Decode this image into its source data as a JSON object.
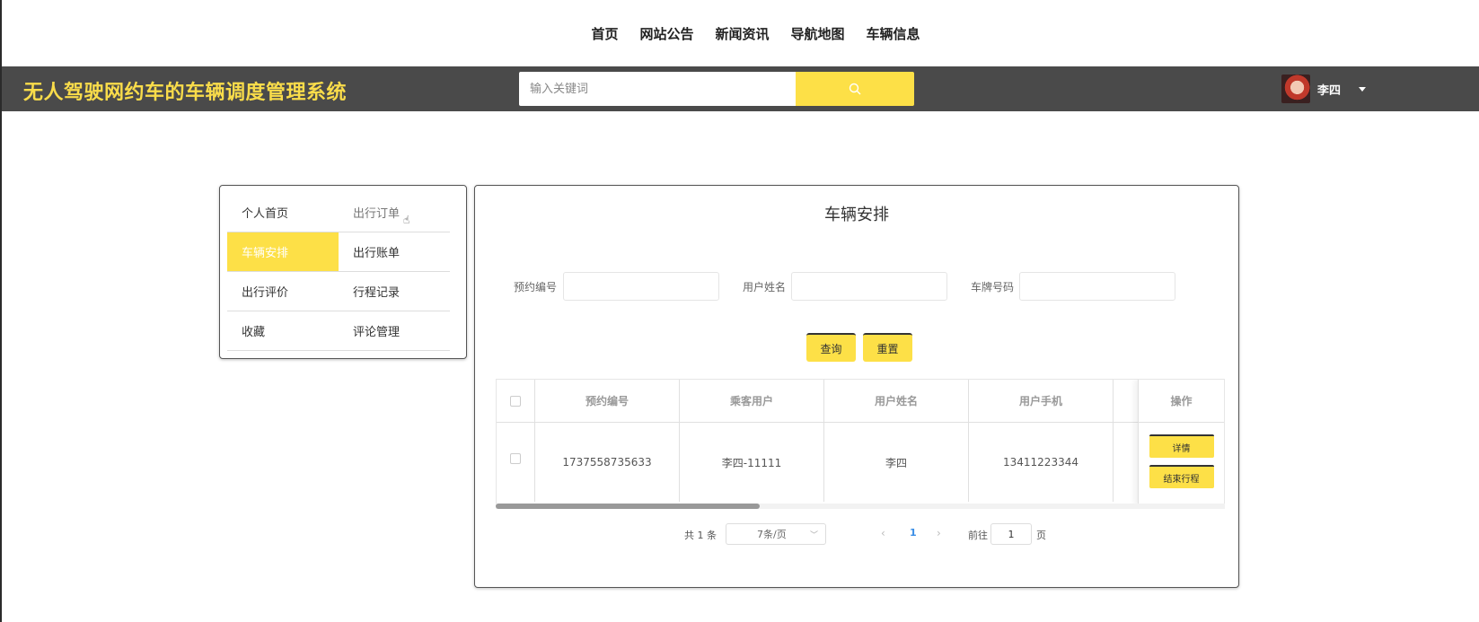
{
  "top_nav": [
    "首页",
    "网站公告",
    "新闻资讯",
    "导航地图",
    "车辆信息"
  ],
  "header": {
    "site_title": "无人驾驶网约车的车辆调度管理系统",
    "search_placeholder": "输入关键词",
    "search_icon": "search-icon",
    "user_name": "李四"
  },
  "side_menu": [
    {
      "label": "个人首页"
    },
    {
      "label": "出行订单"
    },
    {
      "label": "车辆安排",
      "active": true
    },
    {
      "label": "出行账单"
    },
    {
      "label": "出行评价"
    },
    {
      "label": "行程记录"
    },
    {
      "label": "收藏"
    },
    {
      "label": "评论管理"
    }
  ],
  "main": {
    "title": "车辆安排",
    "filters": [
      {
        "label": "预约编号",
        "value": ""
      },
      {
        "label": "用户姓名",
        "value": ""
      },
      {
        "label": "车牌号码",
        "value": ""
      }
    ],
    "query_button": "查询",
    "reset_button": "重置",
    "table": {
      "columns": [
        "预约编号",
        "乘客用户",
        "用户姓名",
        "用户手机",
        "操作"
      ],
      "rows": [
        {
          "cells": [
            "1737558735633",
            "李四-11111",
            "李四",
            "13411223344"
          ],
          "actions": [
            "详情",
            "结束行程"
          ]
        }
      ]
    },
    "pagination": {
      "total": "共 1 条",
      "page_size": "7条/页",
      "current_page": "1",
      "goto_label": "前往",
      "goto_value": "1",
      "page_label": "页"
    }
  },
  "colors": {
    "accent": "#fde047",
    "header_bg": "#4a4a4a",
    "title": "#f9dc4a"
  }
}
